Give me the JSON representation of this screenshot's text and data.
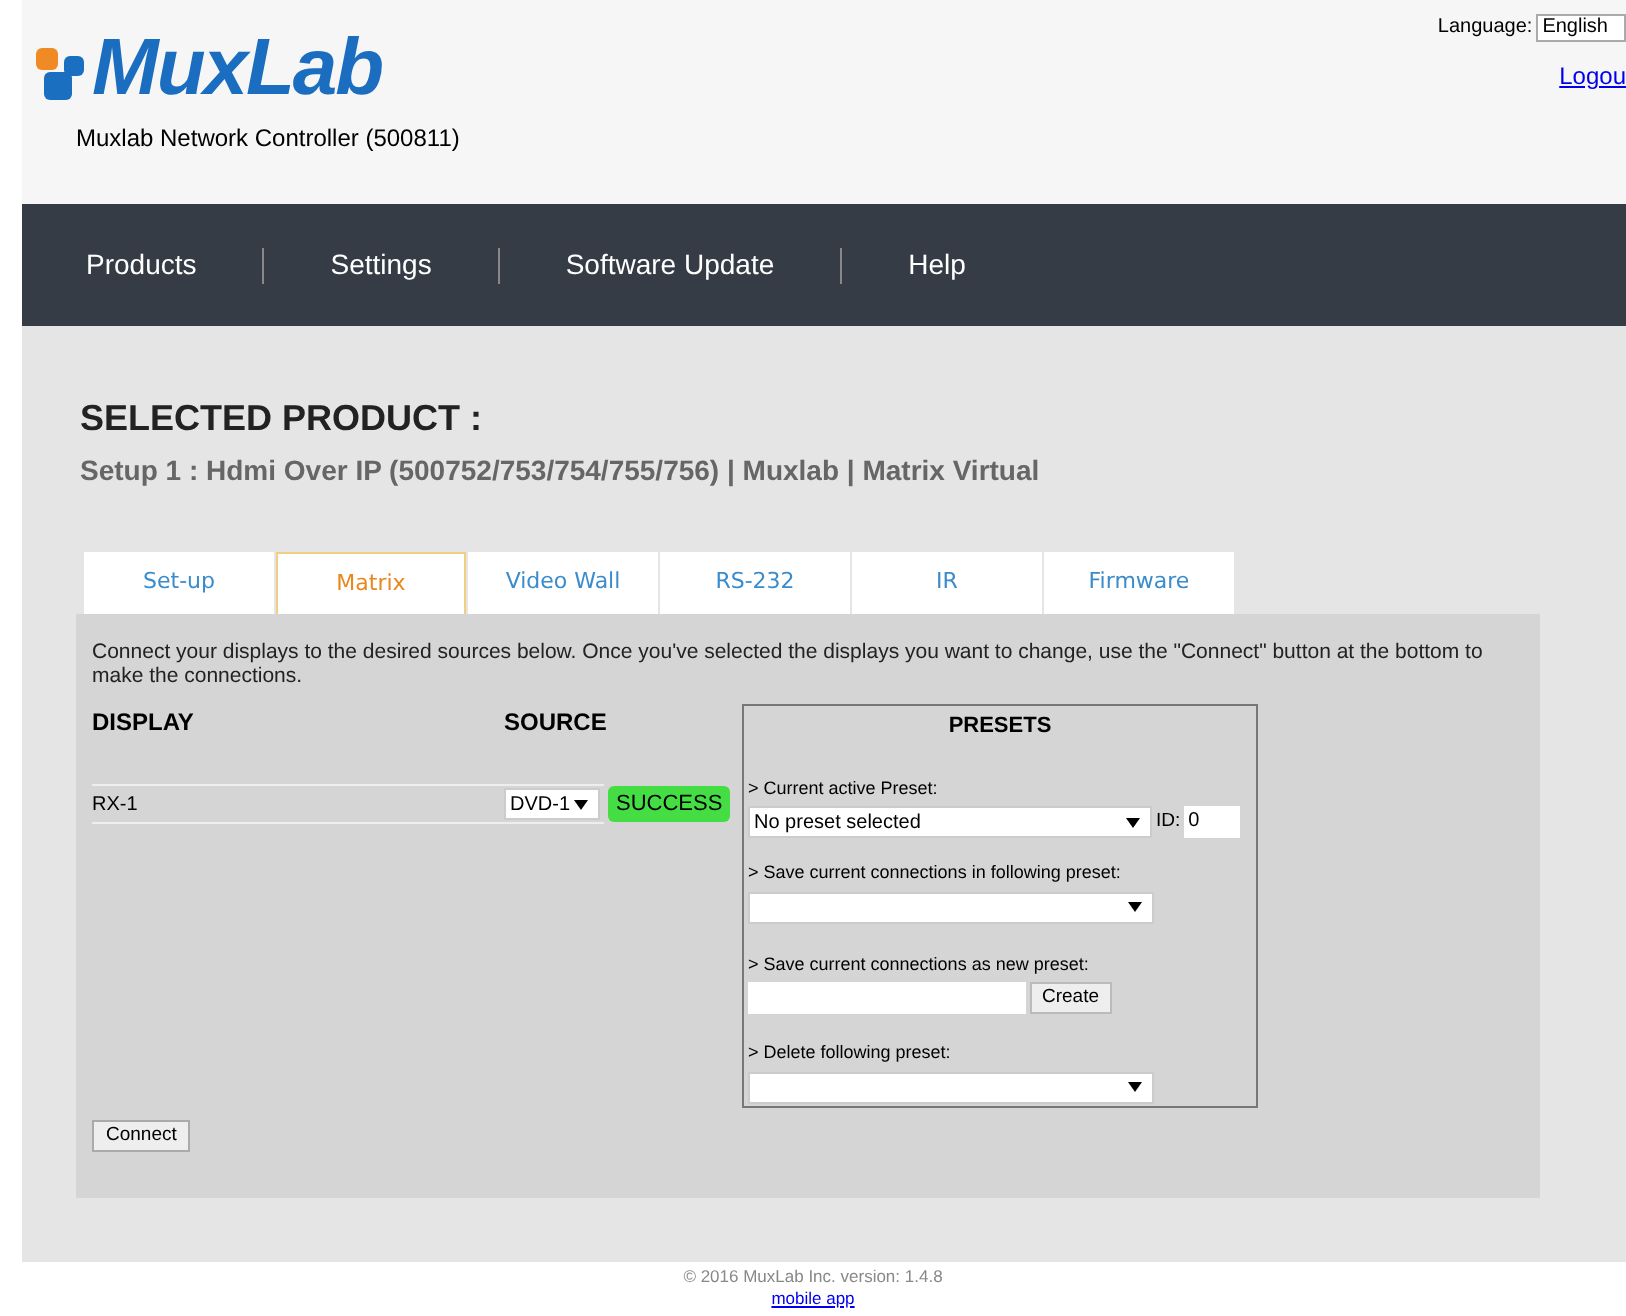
{
  "header": {
    "logo": "MuxLab",
    "subtitle": "Muxlab Network Controller (500811)",
    "language_label": "Language:",
    "language_value": "English",
    "logout": "Logou"
  },
  "nav": [
    "Products",
    "Settings",
    "Software Update",
    "Help"
  ],
  "selected_product": {
    "title": "SELECTED PRODUCT :",
    "subtitle": "Setup 1 : Hdmi Over IP (500752/753/754/755/756) | Muxlab | Matrix Virtual"
  },
  "tabs": [
    {
      "label": "Set-up",
      "selected": false
    },
    {
      "label": "Matrix",
      "selected": true
    },
    {
      "label": "Video Wall",
      "selected": false
    },
    {
      "label": "RS-232",
      "selected": false
    },
    {
      "label": "IR",
      "selected": false
    },
    {
      "label": "Firmware",
      "selected": false
    }
  ],
  "matrix": {
    "intro": "Connect your displays to the desired sources below. Once you've selected the displays you want to change, use the \"Connect\" button at the bottom to make the connections.",
    "columns": [
      "DISPLAY",
      "SOURCE"
    ],
    "rows": [
      {
        "display": "RX-1",
        "source": "DVD-1",
        "status": "SUCCESS"
      }
    ],
    "connect_button": "Connect"
  },
  "presets": {
    "title": "PRESETS",
    "current_label": "> Current active Preset:",
    "current_value": "No preset selected",
    "id_label": "ID:",
    "id_value": "0",
    "save_in_label": "> Save current connections in following preset:",
    "save_new_label": "> Save current connections as new preset:",
    "create_button": "Create",
    "delete_label": "> Delete following preset:"
  },
  "footer": {
    "copyright": "© 2016 MuxLab Inc. version: 1.4.8",
    "link": "mobile app"
  }
}
